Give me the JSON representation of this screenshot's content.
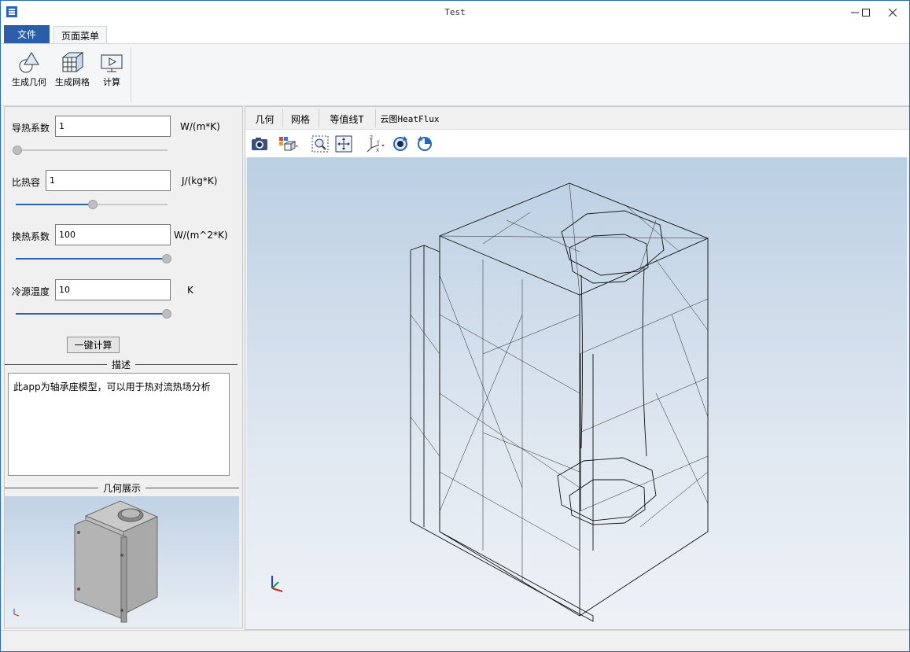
{
  "window": {
    "title": "Test"
  },
  "menu": {
    "file": "文件",
    "page_menu": "页面菜单"
  },
  "ribbon": {
    "gen_geometry": "生成几何",
    "gen_mesh": "生成网格",
    "compute": "计算"
  },
  "params": {
    "conductivity": {
      "label": "导热系数",
      "value": "1",
      "unit": "W/(m*K)",
      "slider": 0.0
    },
    "specific_heat": {
      "label": "比热容",
      "value": "1",
      "unit": "J/(kg*K)",
      "slider": 0.5
    },
    "convection": {
      "label": "换热系数",
      "value": "100",
      "unit": "W/(m^2*K)",
      "slider": 1.0
    },
    "cold_temp": {
      "label": "冷源温度",
      "value": "10",
      "unit": "K",
      "slider": 1.0
    }
  },
  "buttons": {
    "one_click": "一键计算"
  },
  "description": {
    "header": "描述",
    "text": "此app为轴承座模型，可以用于热对流热场分析"
  },
  "geometry_preview": {
    "header": "几何展示"
  },
  "view_tabs": [
    "几何",
    "网格",
    "等值线T",
    "云图HeatFlux"
  ],
  "colors": {
    "accent": "#2a5fa8",
    "mesh_line": "#1a1a1a",
    "viewport_top": "#bbcfe3",
    "viewport_bottom": "#eef2f7"
  }
}
